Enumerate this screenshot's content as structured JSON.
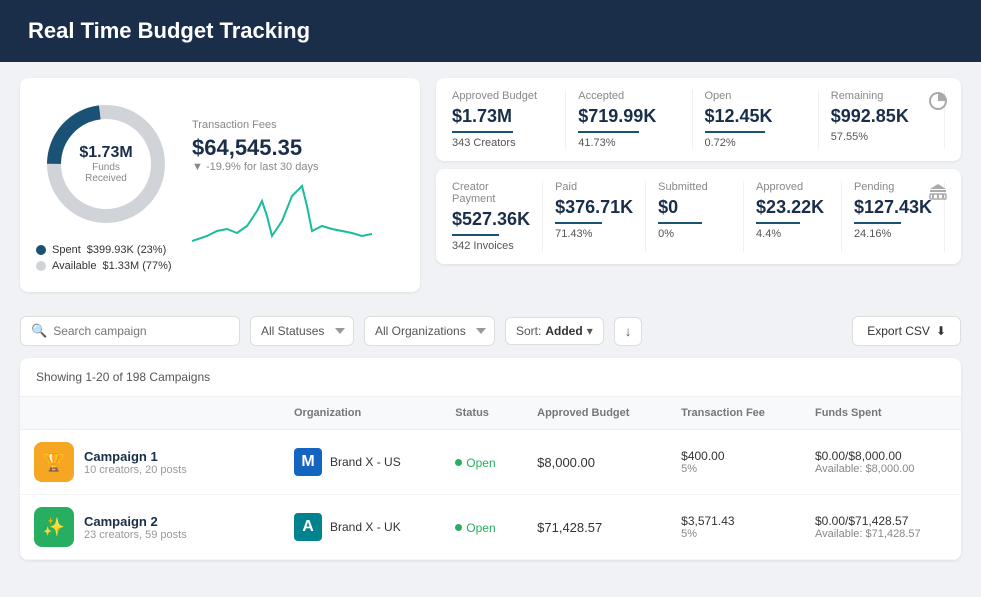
{
  "header": {
    "title": "Real Time Budget Tracking"
  },
  "donut": {
    "amount": "$1.73M",
    "label": "Funds Received",
    "spent_label": "Spent",
    "spent_value": "$399.93K (23%)",
    "available_label": "Available",
    "available_value": "$1.33M (77%)",
    "spent_pct": 23,
    "available_pct": 77
  },
  "transaction": {
    "label": "Transaction Fees",
    "amount": "$64,545.35",
    "change": "▼ -19.9%",
    "change_suffix": "for last 30 days"
  },
  "approved_budget": {
    "label": "Approved Budget",
    "value": "$1.73M",
    "sub": "343 Creators",
    "accepted_label": "Accepted",
    "accepted_value": "$719.99K",
    "accepted_sub": "41.73%",
    "open_label": "Open",
    "open_value": "$12.45K",
    "open_sub": "0.72%",
    "remaining_label": "Remaining",
    "remaining_value": "$992.85K",
    "remaining_sub": "57.55%"
  },
  "creator_payment": {
    "label": "Creator Payment",
    "value": "$527.36K",
    "sub": "342 Invoices",
    "paid_label": "Paid",
    "paid_value": "$376.71K",
    "paid_sub": "71.43%",
    "submitted_label": "Submitted",
    "submitted_value": "$0",
    "submitted_sub": "0%",
    "approved_label": "Approved",
    "approved_value": "$23.22K",
    "approved_sub": "4.4%",
    "pending_label": "Pending",
    "pending_value": "$127.43K",
    "pending_sub": "24.16%"
  },
  "filters": {
    "search_placeholder": "Search campaign",
    "status_options": [
      "All Statuses"
    ],
    "org_options": [
      "All Organizations"
    ],
    "sort_label": "Sort:",
    "sort_value": "Added",
    "export_label": "Export CSV"
  },
  "table": {
    "showing": "Showing 1-20 of 198 Campaigns",
    "columns": [
      "Organization",
      "Status",
      "Approved Budget",
      "Transaction Fee",
      "Funds Spent"
    ],
    "rows": [
      {
        "campaign_name": "Campaign 1",
        "campaign_meta": "10 creators, 20 posts",
        "avatar_emoji": "🏆",
        "avatar_bg": "#f5a623",
        "org_name": "Brand X - US",
        "org_initial": "M",
        "org_color": "blue",
        "status": "Open",
        "approved_budget": "$8,000.00",
        "tx_fee_value": "$400.00",
        "tx_fee_pct": "5%",
        "funds_spent": "$0.00/$8,000.00",
        "funds_available": "Available: $8,000.00"
      },
      {
        "campaign_name": "Campaign 2",
        "campaign_meta": "23 creators, 59 posts",
        "avatar_emoji": "✨",
        "avatar_bg": "#27ae60",
        "org_name": "Brand X - UK",
        "org_initial": "A",
        "org_color": "teal",
        "status": "Open",
        "approved_budget": "$71,428.57",
        "tx_fee_value": "$3,571.43",
        "tx_fee_pct": "5%",
        "funds_spent": "$0.00/$71,428.57",
        "funds_available": "Available: $71,428.57"
      }
    ]
  }
}
